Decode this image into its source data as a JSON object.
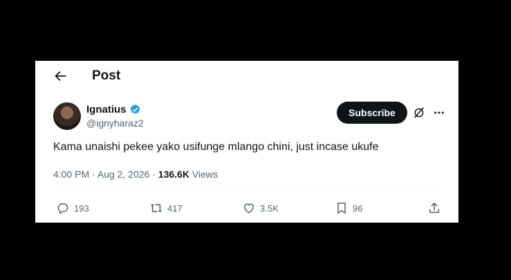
{
  "header": {
    "title": "Post"
  },
  "author": {
    "name": "Ignatius",
    "handle": "@ignyharaz2"
  },
  "subscribe_label": "Subscribe",
  "post": {
    "text": "Kama unaishi pekee yako usifunge mlango chini, just incase ukufe",
    "time": "4:00 PM",
    "date": "Aug 2, 2026",
    "views_count": "136.6K",
    "views_label": "Views"
  },
  "actions": {
    "replies": "193",
    "reposts": "417",
    "likes": "3.5K",
    "bookmarks": "96"
  },
  "colors": {
    "text": "#0f1419",
    "muted": "#536471",
    "verified": "#1d9bf0"
  }
}
